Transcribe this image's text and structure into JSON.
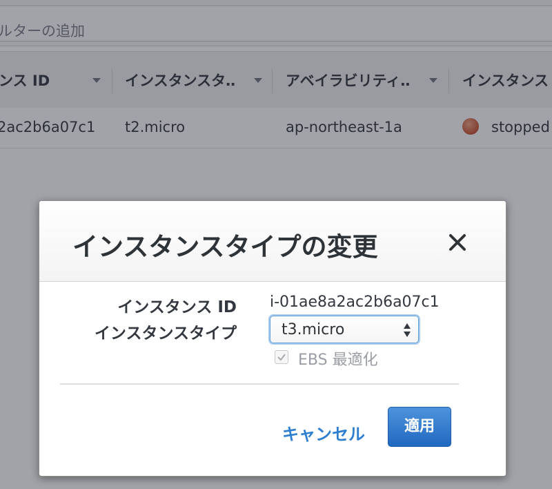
{
  "filter_bar": {
    "placeholder_text": "ルターの追加"
  },
  "table": {
    "columns": [
      {
        "label": "ンス ID",
        "sortable": true
      },
      {
        "label": "インスタンスタ‥",
        "sortable": true
      },
      {
        "label": "アベイラビリティ‥",
        "sortable": true
      },
      {
        "label": "インスタンス",
        "sortable": true
      }
    ],
    "rows": [
      {
        "instance_id": "2ac2b6a07c1",
        "instance_type": "t2.micro",
        "availability_zone": "ap-northeast-1a",
        "state": "stopped",
        "state_color": "#c8502f"
      }
    ]
  },
  "modal": {
    "title": "インスタンスタイプの変更",
    "close_icon": "close-icon",
    "fields": {
      "instance_id_label": "インスタンス ID",
      "instance_id_value": "i-01ae8a2ac2b6a07c1",
      "instance_type_label": "インスタンスタイプ",
      "instance_type_value": "t3.micro"
    },
    "ebs_checkbox": {
      "label": "EBS 最適化",
      "checked": true,
      "disabled": true
    },
    "cancel_label": "キャンセル",
    "apply_label": "適用"
  },
  "colors": {
    "accent": "#2f7fd1",
    "primary_button": "#2169c0",
    "overlay": "#1e2430"
  }
}
